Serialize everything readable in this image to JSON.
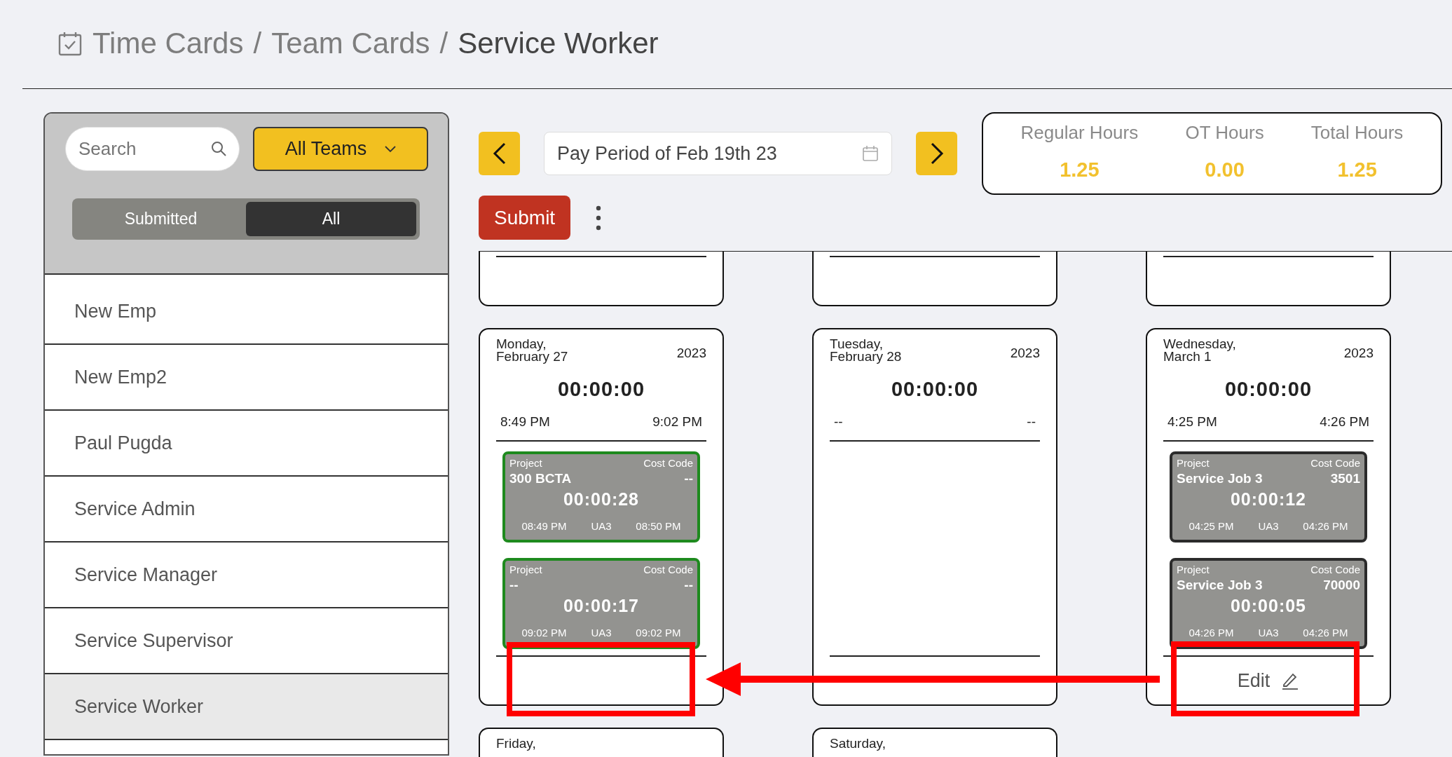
{
  "breadcrumb": {
    "items": [
      {
        "label": "Time Cards",
        "current": false
      },
      {
        "label": "Team Cards",
        "current": false
      },
      {
        "label": "Service Worker",
        "current": true
      }
    ],
    "separators": [
      "/",
      "/"
    ]
  },
  "sidebar": {
    "search": {
      "placeholder": "Search"
    },
    "team_filter": "All Teams",
    "toggle": [
      {
        "label": "Submitted",
        "selected": false
      },
      {
        "label": "All",
        "selected": true
      }
    ],
    "employees": [
      {
        "name": "New Emp",
        "selected": false
      },
      {
        "name": "New Emp2",
        "selected": false
      },
      {
        "name": "Paul Pugda",
        "selected": false
      },
      {
        "name": "Service Admin",
        "selected": false
      },
      {
        "name": "Service Manager",
        "selected": false
      },
      {
        "name": "Service Supervisor",
        "selected": false
      },
      {
        "name": "Service Worker",
        "selected": true
      }
    ]
  },
  "toolbar": {
    "pay_period": "Pay Period of Feb 19th 23",
    "submit": "Submit"
  },
  "hours": [
    {
      "label": "Regular Hours",
      "value": "1.25"
    },
    {
      "label": "OT Hours",
      "value": "0.00"
    },
    {
      "label": "Total Hours",
      "value": "1.25"
    }
  ],
  "days": [
    {
      "kind": "tail"
    },
    {
      "kind": "tail"
    },
    {
      "kind": "tail"
    },
    {
      "kind": "full",
      "weekday": "Monday,",
      "date": "February 27",
      "year": "2023",
      "total": "00:00:00",
      "start": "8:49 PM",
      "end": "9:02 PM",
      "entries": [
        {
          "project_label": "Project",
          "project": "300 BCTA",
          "cost_code_label": "Cost Code",
          "cost_code": "--",
          "duration": "00:00:28",
          "start": "08:49 PM",
          "unit": "UA3",
          "end": "08:50 PM",
          "color": "#1e8a1e"
        },
        {
          "project_label": "Project",
          "project": "--",
          "cost_code_label": "Cost Code",
          "cost_code": "--",
          "duration": "00:00:17",
          "start": "09:02 PM",
          "unit": "UA3",
          "end": "09:02 PM",
          "color": "#1e8a1e"
        }
      ]
    },
    {
      "kind": "full",
      "weekday": "Tuesday,",
      "date": "February 28",
      "year": "2023",
      "total": "00:00:00",
      "start": "--",
      "end": "--"
    },
    {
      "kind": "full",
      "weekday": "Wednesday,",
      "date": "March 1",
      "year": "2023",
      "total": "00:00:00",
      "start": "4:25 PM",
      "end": "4:26 PM",
      "entries": [
        {
          "project_label": "Project",
          "project": "Service Job 3",
          "cost_code_label": "Cost Code",
          "cost_code": "3501",
          "duration": "00:00:12",
          "start": "04:25 PM",
          "unit": "UA3",
          "end": "04:26 PM",
          "color": "#2b2b2b"
        },
        {
          "project_label": "Project",
          "project": "Service Job 3",
          "cost_code_label": "Cost Code",
          "cost_code": "70000",
          "duration": "00:00:05",
          "start": "04:26 PM",
          "unit": "UA3",
          "end": "04:26 PM",
          "color": "#2b2b2b"
        }
      ],
      "edit": "Edit"
    },
    {
      "kind": "head",
      "weekday": "Friday,"
    },
    {
      "kind": "head",
      "weekday": "Saturday,"
    }
  ]
}
